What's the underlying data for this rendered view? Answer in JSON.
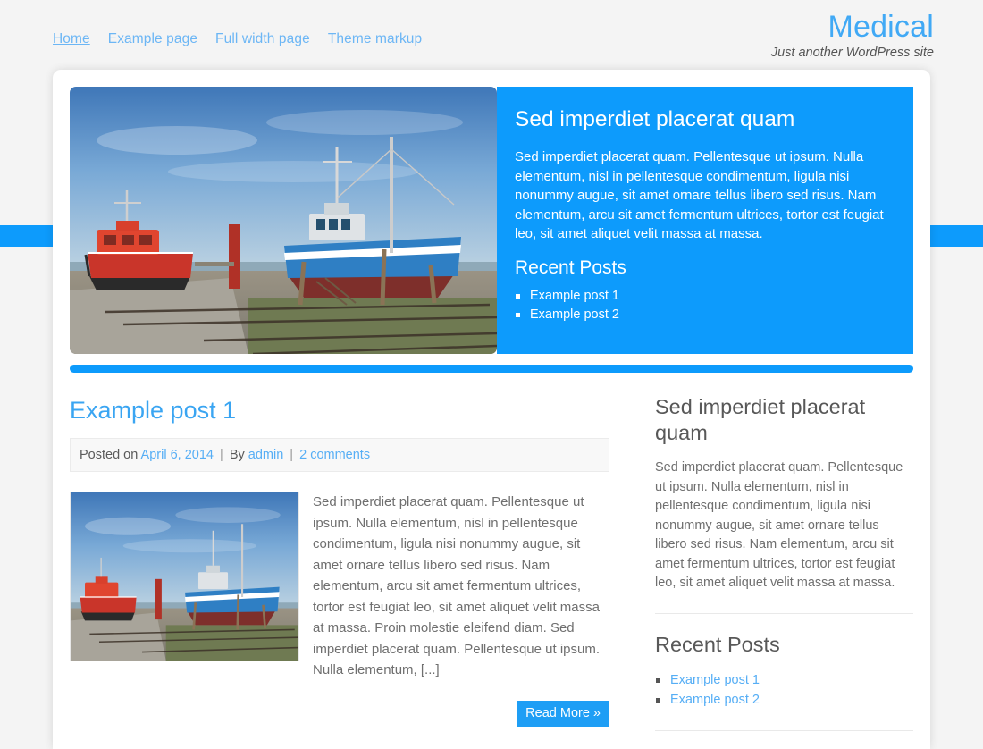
{
  "theme": {
    "accent_blue": "#0d9bfc",
    "link_blue": "#56aef5",
    "title_blue": "#41a9f5",
    "card_bg": "#ffffff",
    "page_bg": "#f4f4f4"
  },
  "header": {
    "nav": [
      {
        "label": "Home",
        "active": true
      },
      {
        "label": "Example page",
        "active": false
      },
      {
        "label": "Full width page",
        "active": false
      },
      {
        "label": "Theme markup",
        "active": false
      }
    ],
    "site_title": "Medical",
    "tagline": "Just another WordPress site"
  },
  "hero": {
    "image_alt": "boats-in-dry-dock-photo",
    "heading": "Sed imperdiet placerat quam",
    "paragraph": "Sed imperdiet placerat quam. Pellentesque ut ipsum. Nulla elementum, nisl in pellentesque condimentum, ligula nisi nonummy augue, sit amet ornare tellus libero sed risus. Nam elementum, arcu sit amet fermentum ultrices, tortor est feugiat leo, sit amet aliquet velit massa at massa.",
    "recent_posts_heading": "Recent Posts",
    "recent_posts": [
      {
        "label": "Example post 1"
      },
      {
        "label": "Example post 2"
      }
    ]
  },
  "post": {
    "title": "Example post 1",
    "meta": {
      "posted_on_label": "Posted on",
      "date": "April 6, 2014",
      "by_label": "By",
      "author": "admin",
      "comments": "2 comments",
      "separator": "|"
    },
    "thumb_alt": "boats-in-dry-dock-thumbnail",
    "excerpt": "Sed imperdiet placerat quam. Pellentesque ut ipsum. Nulla elementum, nisl in pellentesque condimentum, ligula nisi nonummy augue, sit amet ornare tellus libero sed risus. Nam elementum, arcu sit amet fermentum ultrices, tortor est feugiat leo, sit amet aliquet velit massa at massa. Proin molestie eleifend diam. Sed imperdiet placerat quam. Pellentesque ut ipsum. Nulla elementum, [...]",
    "read_more": "Read More »"
  },
  "sidebar": {
    "text_widget": {
      "heading": "Sed imperdiet placerat quam",
      "body": "Sed imperdiet placerat quam. Pellentesque ut ipsum. Nulla elementum, nisl in pellentesque condimentum, ligula nisi nonummy augue, sit amet ornare tellus libero sed risus. Nam elementum, arcu sit amet fermentum ultrices, tortor est feugiat leo, sit amet aliquet velit massa at massa."
    },
    "recent_posts": {
      "heading": "Recent Posts",
      "items": [
        {
          "label": "Example post 1"
        },
        {
          "label": "Example post 2"
        }
      ]
    }
  }
}
